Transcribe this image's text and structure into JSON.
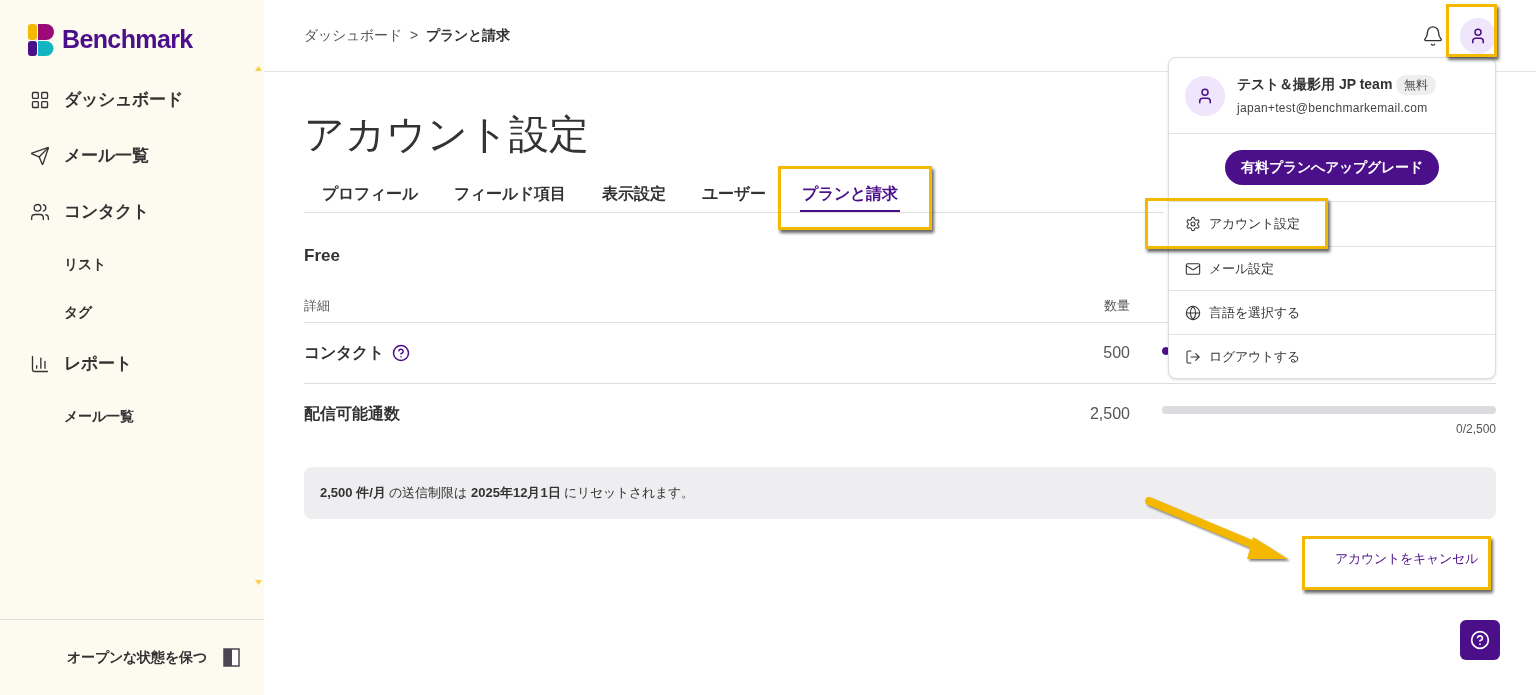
{
  "sidebar": {
    "logo": "Benchmark",
    "items": [
      {
        "label": "ダッシュボード"
      },
      {
        "label": "メール一覧"
      },
      {
        "label": "コンタクト",
        "children": [
          {
            "label": "リスト"
          },
          {
            "label": "タグ"
          }
        ]
      },
      {
        "label": "レポート",
        "children": [
          {
            "label": "メール一覧"
          }
        ]
      }
    ],
    "keep_open": "オープンな状態を保つ"
  },
  "breadcrumb": [
    "ダッシュボード",
    "プランと請求"
  ],
  "breadcrumb_separator": ">",
  "page_title": "アカウント設定",
  "tabs": [
    {
      "label": "プロフィール",
      "selected": false
    },
    {
      "label": "フィールド項目",
      "selected": false
    },
    {
      "label": "表示設定",
      "selected": false
    },
    {
      "label": "ユーザー",
      "selected": false
    },
    {
      "label": "プランと請求",
      "selected": true
    }
  ],
  "plan": {
    "name": "Free",
    "columns": [
      "詳細",
      "数量"
    ],
    "rows": [
      {
        "label": "コンタクト",
        "help": true,
        "quantity": "500",
        "level": 0.02
      },
      {
        "label": "配信可能通数",
        "help": false,
        "quantity": "2,500",
        "reading": "0/2,500"
      }
    ]
  },
  "notice": "**2,500 件/月** の送信制限は **2025年12月1日** にリセットされます。",
  "cancel_link": "アカウントをキャンセル",
  "account_menu": {
    "name": "テスト＆撮影用 JP team",
    "badge": "無料",
    "email": "japan+test@benchmarkemail.com",
    "upgrade": "有料プランへアップグレード",
    "items": [
      {
        "label": "アカウント設定"
      },
      {
        "label": "メール設定"
      },
      {
        "label": "言語を選択する"
      },
      {
        "label": "ログアウトする"
      }
    ]
  }
}
